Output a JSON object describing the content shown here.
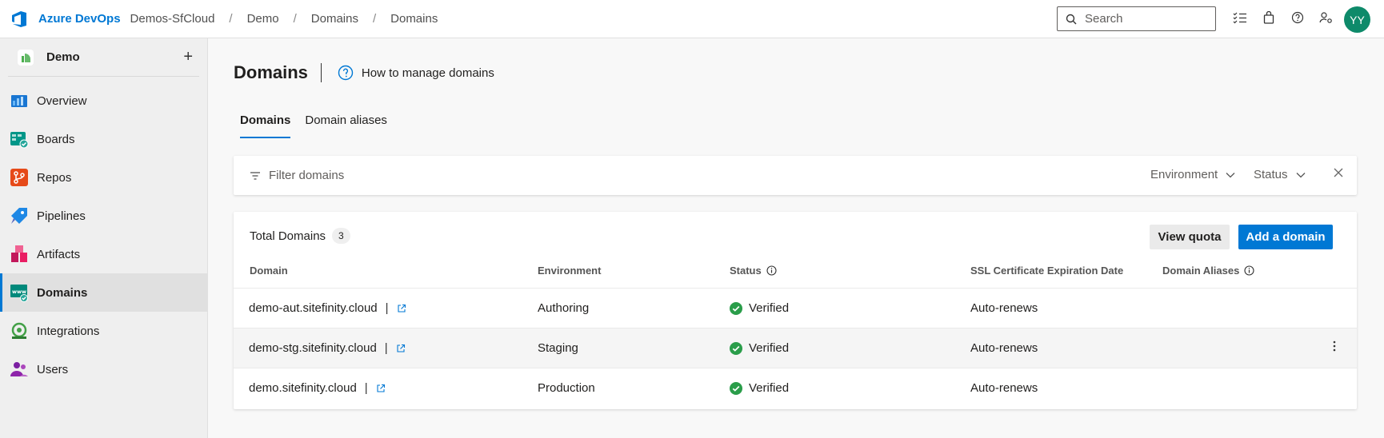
{
  "topbar": {
    "brand": "Azure DevOps",
    "breadcrumbs": [
      "Demos-SfCloud",
      "Demo",
      "Domains",
      "Domains"
    ],
    "breadcrumb_separator": "/",
    "search_placeholder": "Search",
    "avatar_initials": "YY",
    "icons": [
      "checklist-icon",
      "shopping-bag-icon",
      "help-icon",
      "user-settings-icon"
    ]
  },
  "sidebar": {
    "project_name": "Demo",
    "add_label": "+",
    "items": [
      {
        "label": "Overview",
        "icon": "overview-icon"
      },
      {
        "label": "Boards",
        "icon": "boards-icon"
      },
      {
        "label": "Repos",
        "icon": "repos-icon"
      },
      {
        "label": "Pipelines",
        "icon": "pipelines-icon"
      },
      {
        "label": "Artifacts",
        "icon": "artifacts-icon"
      },
      {
        "label": "Domains",
        "icon": "domains-icon",
        "active": true
      },
      {
        "label": "Integrations",
        "icon": "integrations-icon"
      },
      {
        "label": "Users",
        "icon": "users-icon"
      }
    ]
  },
  "main": {
    "title": "Domains",
    "help_link": "How to manage domains",
    "tabs": [
      {
        "label": "Domains",
        "active": true
      },
      {
        "label": "Domain aliases",
        "active": false
      }
    ],
    "filter": {
      "placeholder": "Filter domains",
      "environment_label": "Environment",
      "status_label": "Status"
    },
    "table": {
      "total_label": "Total Domains",
      "total_count": "3",
      "view_quota_label": "View quota",
      "add_domain_label": "Add a domain",
      "columns": [
        "Domain",
        "Environment",
        "Status",
        "SSL Certificate Expiration Date",
        "Domain Aliases"
      ],
      "rows": [
        {
          "domain": "demo-aut.sitefinity.cloud",
          "environment": "Authoring",
          "status": "Verified",
          "ssl": "Auto-renews",
          "aliases": ""
        },
        {
          "domain": "demo-stg.sitefinity.cloud",
          "environment": "Staging",
          "status": "Verified",
          "ssl": "Auto-renews",
          "aliases": ""
        },
        {
          "domain": "demo.sitefinity.cloud",
          "environment": "Production",
          "status": "Verified",
          "ssl": "Auto-renews",
          "aliases": ""
        }
      ]
    }
  },
  "colors": {
    "accent": "#0078d4",
    "verified": "#2a9d4a",
    "avatar": "#0e8a6a"
  }
}
